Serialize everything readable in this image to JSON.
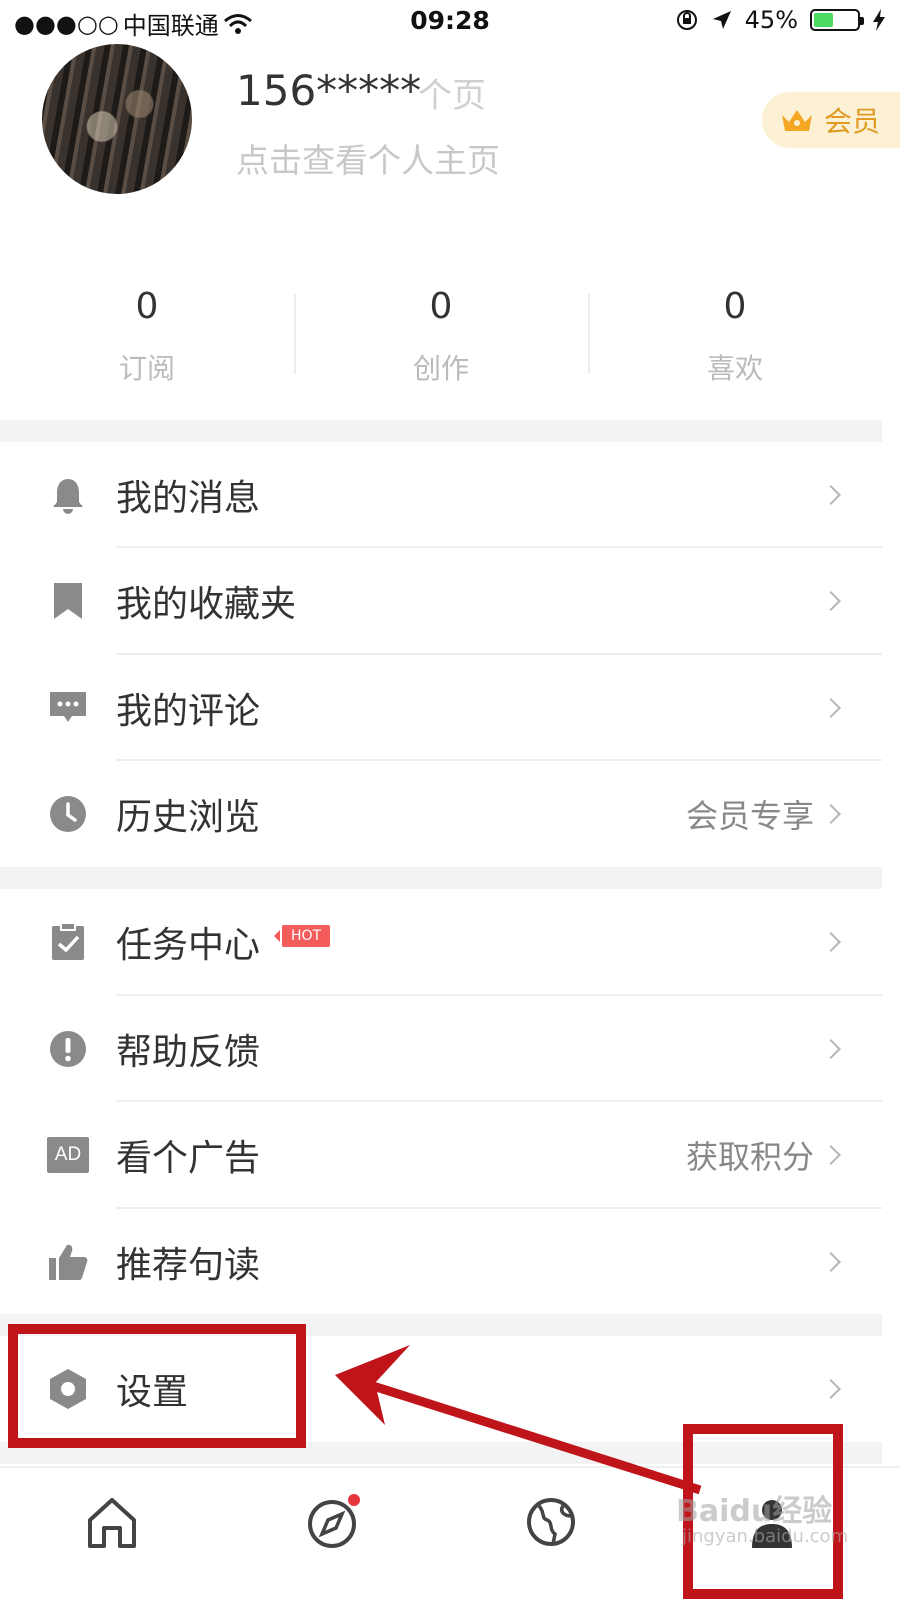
{
  "status_bar": {
    "signal": "●●●○○",
    "carrier": "中国联通",
    "time": "09:28",
    "battery_percent": "45%",
    "battery_level": 0.45
  },
  "profile": {
    "username": "156*****",
    "username_ghost": "个页",
    "subtitle": "点击查看个人主页",
    "vip_label": "会员"
  },
  "stats": [
    {
      "value": "0",
      "label": "订阅"
    },
    {
      "value": "0",
      "label": "创作"
    },
    {
      "value": "0",
      "label": "喜欢"
    }
  ],
  "menu": {
    "messages": "我的消息",
    "favorites": "我的收藏夹",
    "comments": "我的评论",
    "history": "历史浏览",
    "history_extra": "会员专享",
    "tasks": "任务中心",
    "tasks_badge": "HOT",
    "help": "帮助反馈",
    "ads": "看个广告",
    "ads_extra": "获取积分",
    "ads_icon_text": "AD",
    "recommend": "推荐句读",
    "settings": "设置"
  },
  "tabs": [
    "home-icon",
    "compass-icon",
    "globe-icon",
    "profile-icon"
  ],
  "watermark": {
    "main": "Baidu经验",
    "sub": "jingyan.baidu.com"
  },
  "colors": {
    "annotation": "#c0141b",
    "accent": "#f45b5b",
    "vip": "#e09a22"
  }
}
